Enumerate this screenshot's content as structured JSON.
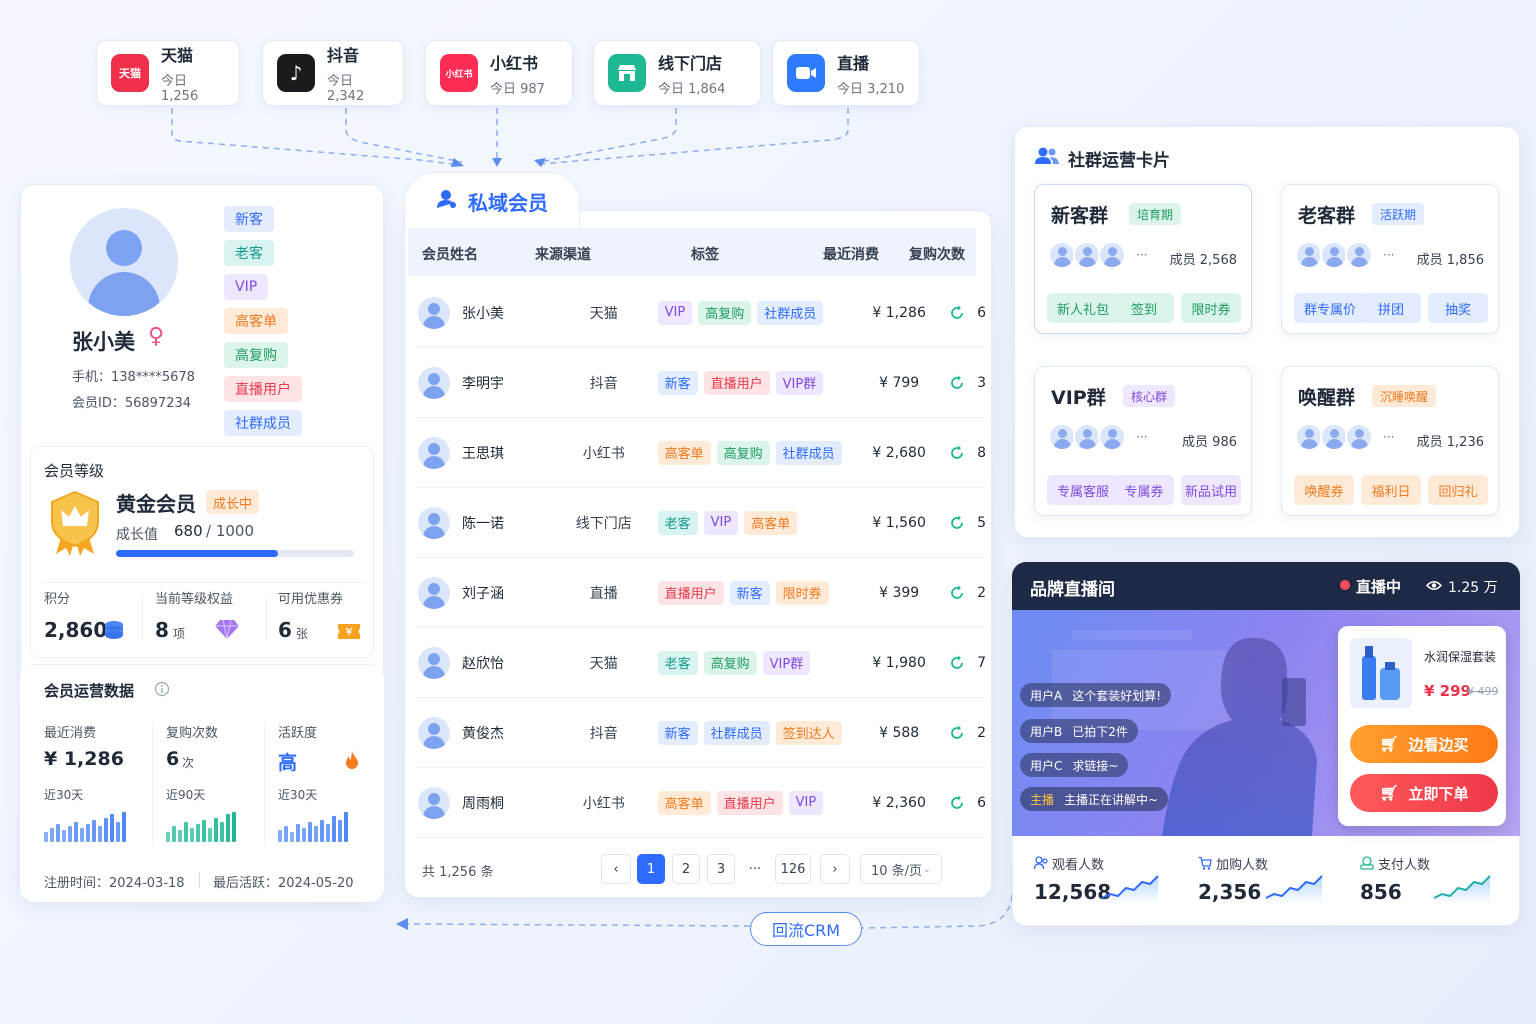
{
  "channels": [
    {
      "name": "天猫",
      "count": "今日 1,256",
      "icon": "tmall-icon",
      "color": "#f0304a",
      "glyph": "天猫"
    },
    {
      "name": "抖音",
      "count": "今日 2,342",
      "icon": "douyin-icon",
      "color": "#1b1b1f",
      "glyph": "♪"
    },
    {
      "name": "小红书",
      "count": "今日 987",
      "icon": "xiaohongshu-icon",
      "color": "#ff2d55",
      "glyph": "小红书"
    },
    {
      "name": "线下门店",
      "count": "今日 1,864",
      "icon": "store-icon",
      "color": "#1fb894",
      "glyph": ""
    },
    {
      "name": "直播",
      "count": "今日 3,210",
      "icon": "live-video-icon",
      "color": "#2f7bff",
      "glyph": ""
    }
  ],
  "hub": {
    "title": "私域会员"
  },
  "profile": {
    "name": "张小美",
    "gender": "♀",
    "phone": "手机：138****5678",
    "member_id": "会员ID：56897234",
    "tags": [
      {
        "t": "新客",
        "c": "t-blue"
      },
      {
        "t": "老客",
        "c": "t-teal"
      },
      {
        "t": "VIP",
        "c": "t-purple"
      },
      {
        "t": "高客单",
        "c": "t-orange"
      },
      {
        "t": "高复购",
        "c": "t-green"
      },
      {
        "t": "直播用户",
        "c": "t-red"
      },
      {
        "t": "社群成员",
        "c": "t-blue"
      }
    ]
  },
  "level": {
    "title": "会员等级",
    "name": "黄金会员",
    "badge": "成长中",
    "growth_label": "成长值",
    "growth_value": "680",
    "growth_max": "/ 1000",
    "progress": 0.68,
    "stats": [
      {
        "label": "积分",
        "value": "2,860",
        "unit": ""
      },
      {
        "label": "当前等级权益",
        "value": "8",
        "unit": "项"
      },
      {
        "label": "可用优惠券",
        "value": "6",
        "unit": "张"
      }
    ]
  },
  "ops": {
    "title": "会员运营数据",
    "items": [
      {
        "label": "最近消费",
        "value": "¥ 1,286",
        "sub": "近30天",
        "unit": ""
      },
      {
        "label": "复购次数",
        "value": "6",
        "unit": "次",
        "sub": "近90天"
      },
      {
        "label": "活跃度",
        "value": "高",
        "unit": "",
        "sub": "近30天"
      }
    ],
    "footer_reg": "注册时间：2024-03-18",
    "footer_active": "最后活跃：2024-05-20"
  },
  "table": {
    "headers": [
      "会员姓名",
      "来源渠道",
      "标签",
      "最近消费",
      "复购次数"
    ],
    "rows": [
      {
        "name": "张小美",
        "ch": "天猫",
        "tags": [
          [
            "VIP",
            "t-purple"
          ],
          [
            "高复购",
            "t-green"
          ],
          [
            "社群成员",
            "t-blue"
          ]
        ],
        "amt": "¥ 1,286",
        "rep": "6"
      },
      {
        "name": "李明宇",
        "ch": "抖音",
        "tags": [
          [
            "新客",
            "t-blue"
          ],
          [
            "直播用户",
            "t-red"
          ],
          [
            "VIP群",
            "t-purple"
          ]
        ],
        "amt": "¥ 799",
        "rep": "3"
      },
      {
        "name": "王思琪",
        "ch": "小红书",
        "tags": [
          [
            "高客单",
            "t-orange"
          ],
          [
            "高复购",
            "t-green"
          ],
          [
            "社群成员",
            "t-blue"
          ]
        ],
        "amt": "¥ 2,680",
        "rep": "8"
      },
      {
        "name": "陈一诺",
        "ch": "线下门店",
        "tags": [
          [
            "老客",
            "t-teal"
          ],
          [
            "VIP",
            "t-purple"
          ],
          [
            "高客单",
            "t-orange"
          ]
        ],
        "amt": "¥ 1,560",
        "rep": "5"
      },
      {
        "name": "刘子涵",
        "ch": "直播",
        "tags": [
          [
            "直播用户",
            "t-red"
          ],
          [
            "新客",
            "t-blue"
          ],
          [
            "限时券",
            "t-orange"
          ]
        ],
        "amt": "¥ 399",
        "rep": "2"
      },
      {
        "name": "赵欣怡",
        "ch": "天猫",
        "tags": [
          [
            "老客",
            "t-teal"
          ],
          [
            "高复购",
            "t-green"
          ],
          [
            "VIP群",
            "t-purple"
          ]
        ],
        "amt": "¥ 1,980",
        "rep": "7"
      },
      {
        "name": "黄俊杰",
        "ch": "抖音",
        "tags": [
          [
            "新客",
            "t-blue"
          ],
          [
            "社群成员",
            "t-blue"
          ],
          [
            "签到达人",
            "t-orange"
          ]
        ],
        "amt": "¥ 588",
        "rep": "2"
      },
      {
        "name": "周雨桐",
        "ch": "小红书",
        "tags": [
          [
            "高客单",
            "t-orange"
          ],
          [
            "直播用户",
            "t-red"
          ],
          [
            "VIP",
            "t-purple"
          ]
        ],
        "amt": "¥ 2,360",
        "rep": "6"
      }
    ],
    "total": "共 1,256 条",
    "pages": [
      "1",
      "2",
      "3",
      "···",
      "126"
    ],
    "page_size": "10 条/页"
  },
  "crm": {
    "label": "回流CRM"
  },
  "community": {
    "title": "社群运营卡片",
    "groups": [
      {
        "name": "新客群",
        "badge": "培育期",
        "badge_c": "t-green",
        "members": "成员 2,568",
        "btns": [
          "新人礼包",
          "签到",
          "限时券"
        ],
        "btn_c": "t-green"
      },
      {
        "name": "老客群",
        "badge": "活跃期",
        "badge_c": "t-blue",
        "members": "成员 1,856",
        "btns": [
          "群专属价",
          "拼团",
          "抽奖"
        ],
        "btn_c": "t-blue"
      },
      {
        "name": "VIP群",
        "badge": "核心群",
        "badge_c": "t-purple",
        "members": "成员 986",
        "btns": [
          "专属客服",
          "专属券",
          "新品试用"
        ],
        "btn_c": "t-purple"
      },
      {
        "name": "唤醒群",
        "badge": "沉睡唤醒",
        "badge_c": "t-orange",
        "members": "成员 1,236",
        "btns": [
          "唤醒券",
          "福利日",
          "回归礼"
        ],
        "btn_c": "t-orange"
      }
    ]
  },
  "live": {
    "title": "品牌直播间",
    "status": "直播中",
    "viewers": "1.25 万",
    "chats": [
      {
        "user": "用户A",
        "text": "这个套装好划算!"
      },
      {
        "user": "用户B",
        "text": "已拍下2件"
      },
      {
        "user": "用户C",
        "text": "求链接~"
      },
      {
        "user": "主播",
        "text": "主播正在讲解中~"
      }
    ],
    "product": {
      "name": "水润保湿套装",
      "price": "¥ 299",
      "orig": "¥ 499"
    },
    "btn_watch": "边看边买",
    "btn_order": "立即下单",
    "stats": [
      {
        "label": "观看人数",
        "value": "12,568"
      },
      {
        "label": "加购人数",
        "value": "2,356"
      },
      {
        "label": "支付人数",
        "value": "856"
      }
    ]
  }
}
